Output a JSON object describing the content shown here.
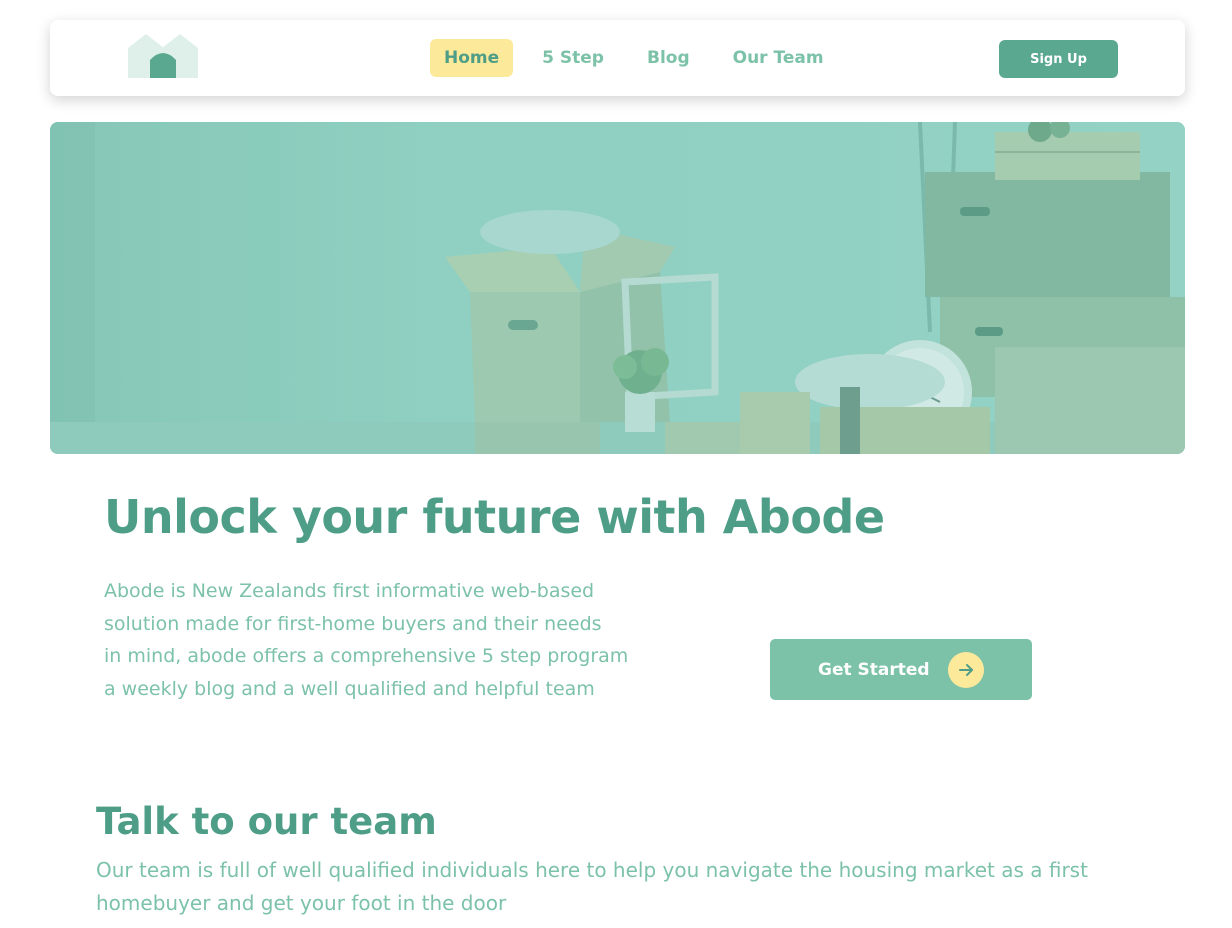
{
  "nav": {
    "links": [
      {
        "label": "Home",
        "active": true
      },
      {
        "label": "5 Step",
        "active": false
      },
      {
        "label": "Blog",
        "active": false
      },
      {
        "label": "Our Team",
        "active": false
      }
    ],
    "signup_label": "Sign Up",
    "logo_icon": "house-logo-icon"
  },
  "hero": {
    "image": "moving-boxes-photo"
  },
  "intro": {
    "headline": "Unlock your future with Abode",
    "lines": [
      "Abode is New Zealands first informative web-based",
      "solution made for first-home buyers and their needs",
      "in mind, abode offers a comprehensive 5 step program",
      "a weekly blog and a well qualified and helpful team"
    ],
    "cta_label": "Get Started",
    "cta_icon": "arrow-right-icon"
  },
  "team": {
    "heading": "Talk to our team",
    "text": "Our team is full of well qualified individuals here to help you navigate the housing market as a first homebuyer and get your foot in the door"
  },
  "colors": {
    "primary": "#4e9e87",
    "secondary": "#7cc2a9",
    "accent": "#fde99a",
    "button": "#5ba891",
    "hero_tint": "#8ecdbf"
  }
}
